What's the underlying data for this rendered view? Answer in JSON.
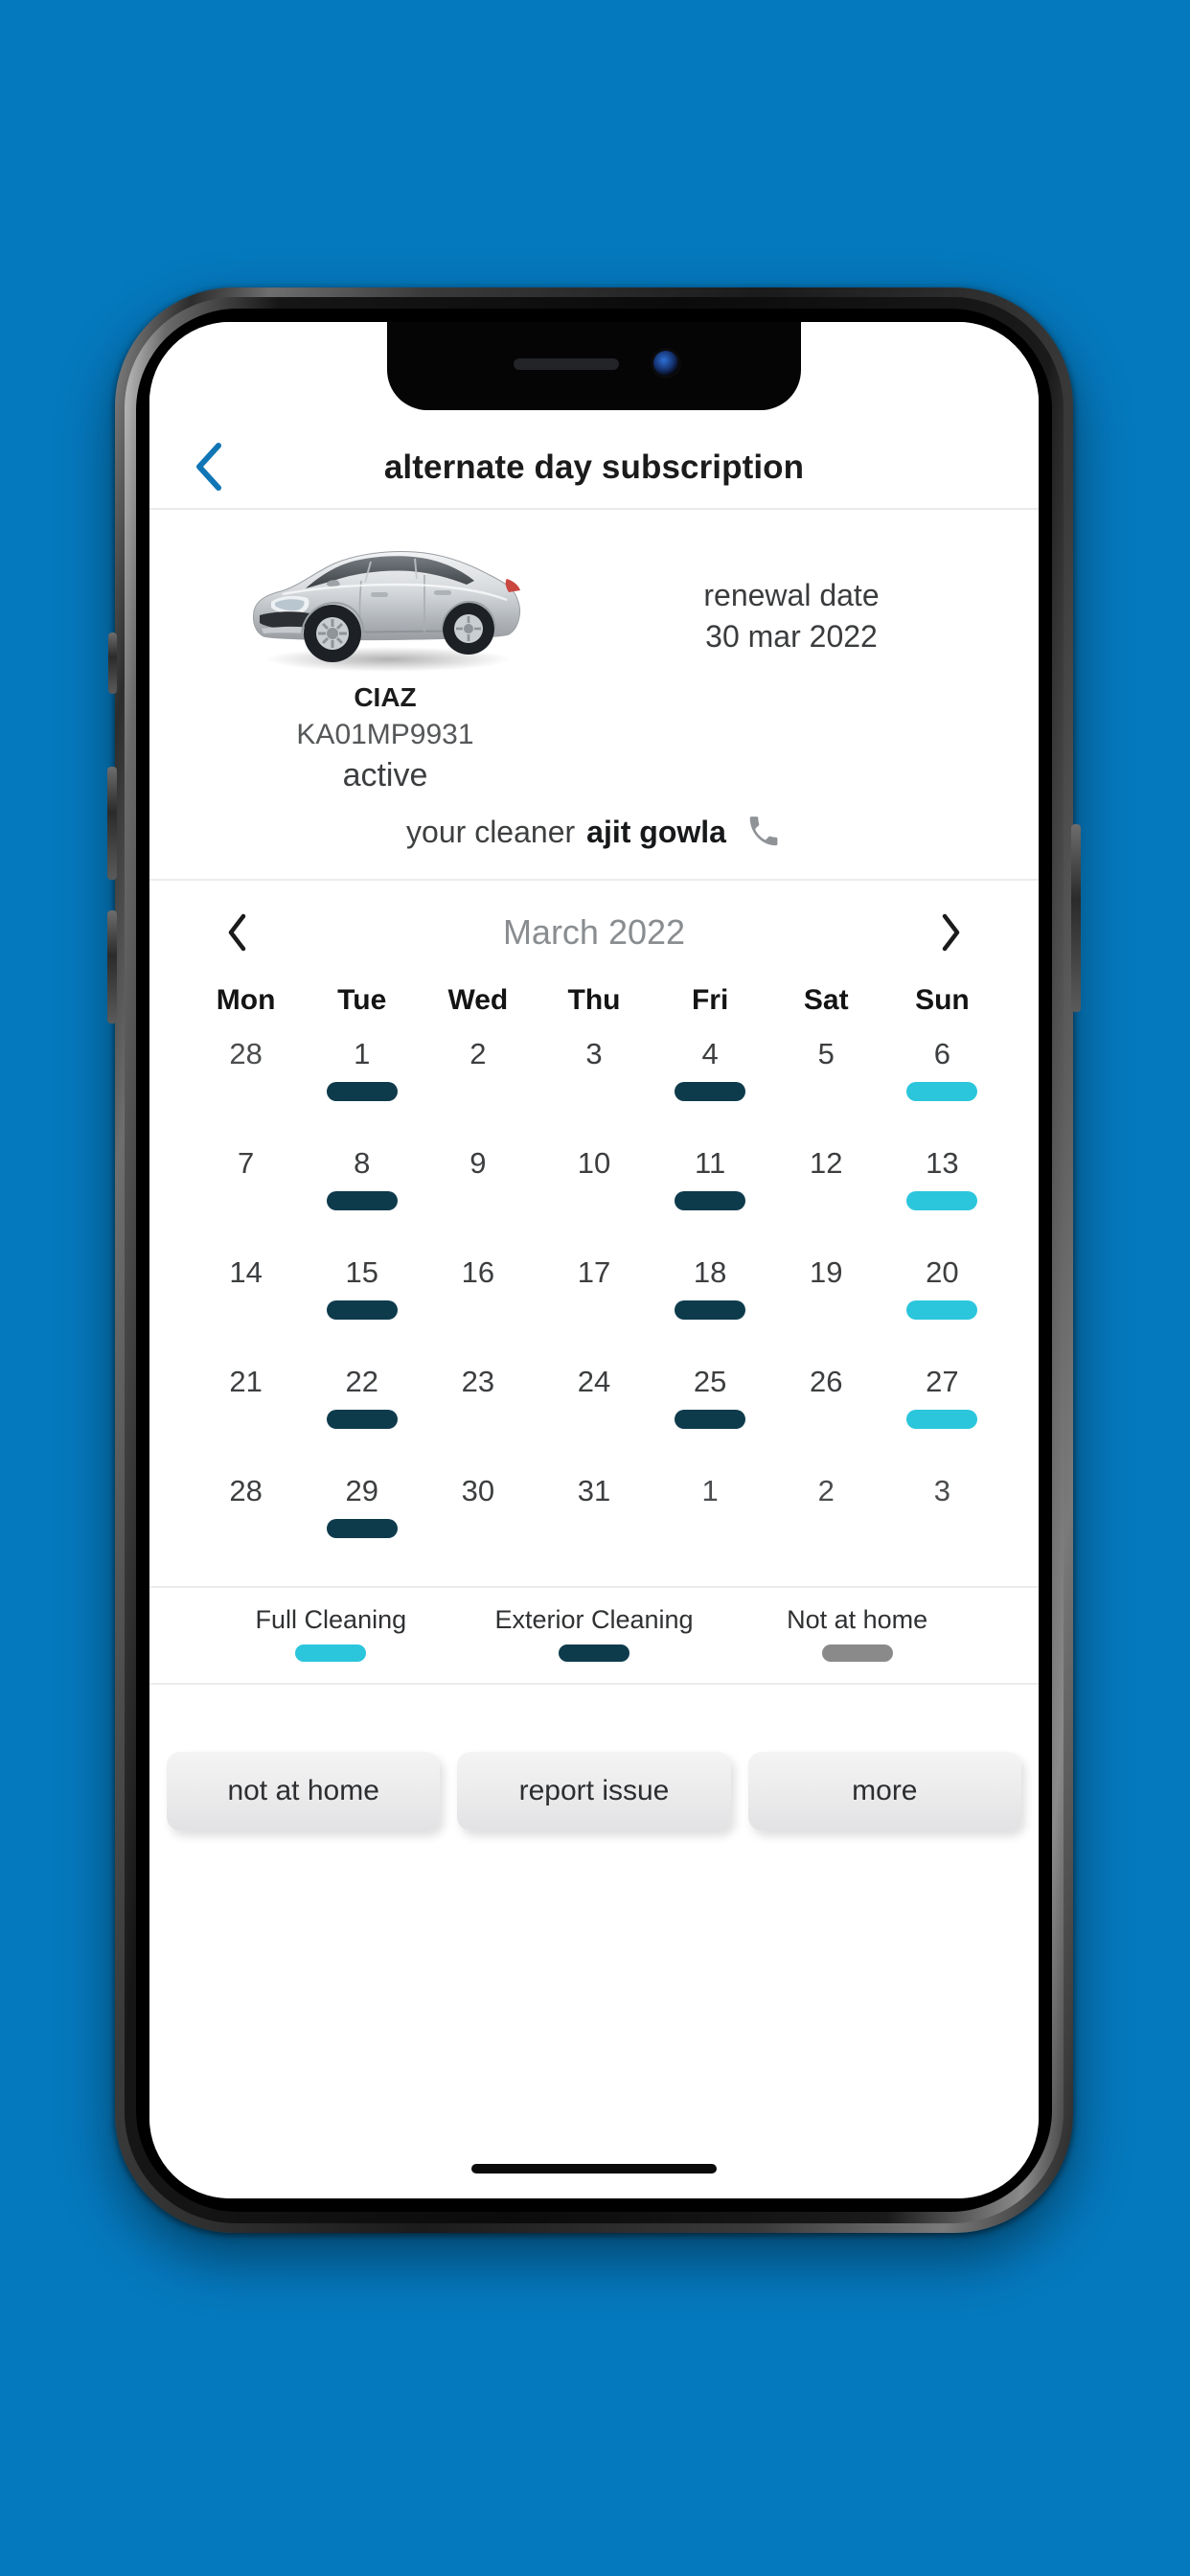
{
  "theme": {
    "background": "#0579BE",
    "accent_blue": "#1076B5",
    "full_cleaning": "#2BC6DC",
    "exterior_cleaning": "#0E3B4C",
    "not_at_home": "#8A8A8A"
  },
  "appbar": {
    "back_label": "back",
    "title": "alternate day subscription"
  },
  "vehicle": {
    "name": "CIAZ",
    "plate": "KA01MP9931",
    "status": "active",
    "renewal_label": "renewal date",
    "renewal_date": "30 mar 2022",
    "cleaner_label": "your cleaner",
    "cleaner_name": "ajit gowla",
    "call_icon": "phone-icon"
  },
  "calendar": {
    "month": "March 2022",
    "prev_label": "previous month",
    "next_label": "next month",
    "weekdays": [
      "Mon",
      "Tue",
      "Wed",
      "Thu",
      "Fri",
      "Sat",
      "Sun"
    ],
    "weeks": [
      [
        {
          "day": "28",
          "type": "none",
          "outside": true
        },
        {
          "day": "1",
          "type": "exterior"
        },
        {
          "day": "2",
          "type": "none"
        },
        {
          "day": "3",
          "type": "none"
        },
        {
          "day": "4",
          "type": "exterior"
        },
        {
          "day": "5",
          "type": "none"
        },
        {
          "day": "6",
          "type": "full"
        }
      ],
      [
        {
          "day": "7",
          "type": "none"
        },
        {
          "day": "8",
          "type": "exterior"
        },
        {
          "day": "9",
          "type": "none"
        },
        {
          "day": "10",
          "type": "none"
        },
        {
          "day": "11",
          "type": "exterior"
        },
        {
          "day": "12",
          "type": "none"
        },
        {
          "day": "13",
          "type": "full"
        }
      ],
      [
        {
          "day": "14",
          "type": "none"
        },
        {
          "day": "15",
          "type": "exterior"
        },
        {
          "day": "16",
          "type": "none"
        },
        {
          "day": "17",
          "type": "none"
        },
        {
          "day": "18",
          "type": "exterior"
        },
        {
          "day": "19",
          "type": "none"
        },
        {
          "day": "20",
          "type": "full"
        }
      ],
      [
        {
          "day": "21",
          "type": "none"
        },
        {
          "day": "22",
          "type": "exterior"
        },
        {
          "day": "23",
          "type": "none"
        },
        {
          "day": "24",
          "type": "none"
        },
        {
          "day": "25",
          "type": "exterior"
        },
        {
          "day": "26",
          "type": "none"
        },
        {
          "day": "27",
          "type": "full"
        }
      ],
      [
        {
          "day": "28",
          "type": "none"
        },
        {
          "day": "29",
          "type": "exterior"
        },
        {
          "day": "30",
          "type": "none"
        },
        {
          "day": "31",
          "type": "none"
        },
        {
          "day": "1",
          "type": "none",
          "outside": true
        },
        {
          "day": "2",
          "type": "none",
          "outside": true
        },
        {
          "day": "3",
          "type": "none",
          "outside": true
        }
      ]
    ]
  },
  "legend": [
    {
      "label": "Full Cleaning",
      "color": "#2BC6DC"
    },
    {
      "label": "Exterior Cleaning",
      "color": "#0E3B4C"
    },
    {
      "label": "Not at home",
      "color": "#8A8A8A"
    }
  ],
  "actions": [
    {
      "label": "not at home"
    },
    {
      "label": "report issue"
    },
    {
      "label": "more"
    }
  ]
}
